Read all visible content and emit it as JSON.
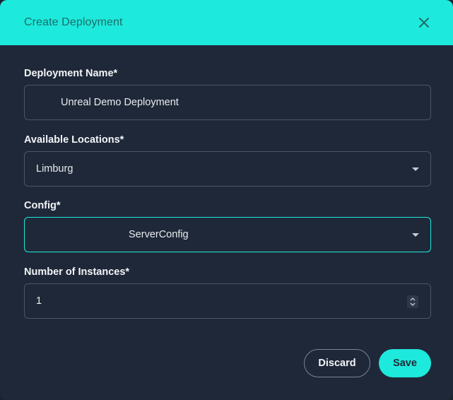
{
  "dialog": {
    "title": "Create Deployment",
    "close_icon": "close-icon"
  },
  "form": {
    "deployment_name": {
      "label": "Deployment Name*",
      "value": "Unreal Demo Deployment"
    },
    "locations": {
      "label": "Available Locations*",
      "selected": "Limburg",
      "icon": "chevron-down-icon"
    },
    "config": {
      "label": "Config*",
      "selected": "ServerConfig",
      "icon": "chevron-down-icon"
    },
    "instances": {
      "label": "Number of Instances*",
      "value": "1",
      "icon": "stepper-icon"
    }
  },
  "actions": {
    "discard_label": "Discard",
    "save_label": "Save"
  },
  "colors": {
    "accent": "#1de9dc",
    "background": "#1f2838",
    "header_text": "#1e6e6a"
  }
}
